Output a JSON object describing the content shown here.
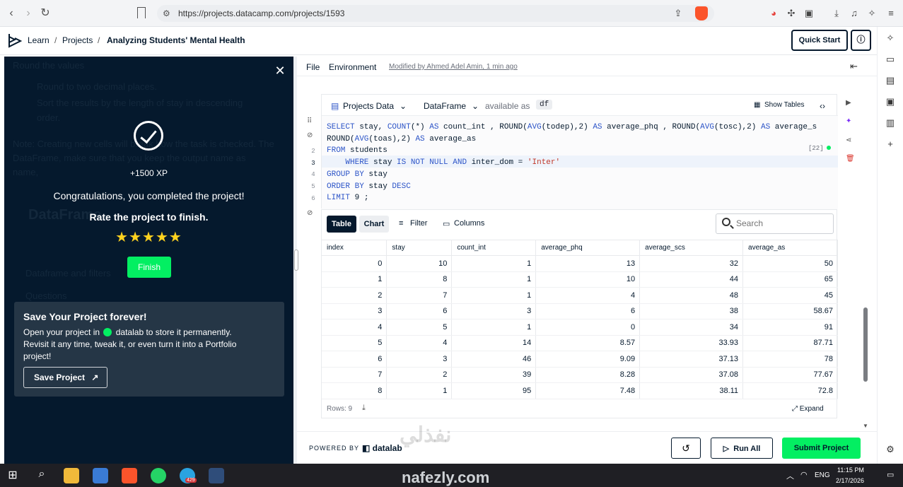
{
  "browser": {
    "url": "https://projects.datacamp.com/projects/1593",
    "notification_count": "429"
  },
  "header": {
    "breadcrumb": [
      "Learn",
      "Projects",
      "Analyzing Students' Mental Health"
    ],
    "quick_start": "Quick Start"
  },
  "panel": {
    "xp": "+1500 XP",
    "congrats": "Congratulations, you completed the project!",
    "rate": "Rate the project to finish.",
    "stars": "★★★★★",
    "finish": "Finish",
    "save_title": "Save Your Project forever!",
    "save_desc_1": "Open your project in",
    "save_desc_brand": "datalab",
    "save_desc_2": "to store it permanently. Revisit it any time, tweak it, or even turn it into a Portfolio project!",
    "save_button": "Save Project",
    "ghost": {
      "line1": "Round the values",
      "line2": "Round to two decimal places.",
      "line3": "Sort the results by the length of stay in descending",
      "line4": "order.",
      "line5": "Note: Creating new cells will break how the task is checked. The",
      "line6": "DataFrame, make sure that you keep the output name as",
      "line7": "name,",
      "line8": "DataFrame",
      "line9": "Dataframe and filters",
      "line10": "Questions"
    }
  },
  "notebook": {
    "menu": [
      "File",
      "Environment"
    ],
    "modified": "Modified by Ahmed Adel Amin, 1 min ago",
    "source": "Projects Data",
    "output_type": "DataFrame",
    "available_as": "available as",
    "df_name": "df",
    "show_tables": "Show Tables",
    "row_badge": "[22]",
    "code_lines": [
      "SELECT stay, COUNT(*) AS count_int , ROUND(AVG(todep),2) AS average_phq , ROUND(AVG(tosc),2) AS average_s",
      "ROUND(AVG(toas),2) AS average_as",
      "FROM students",
      "    WHERE stay IS NOT NULL AND inter_dom = 'Inter'",
      "GROUP BY stay",
      "ORDER BY stay DESC",
      "LIMIT 9 ;"
    ],
    "line_numbers": [
      "2",
      "3",
      "4",
      "5",
      "6"
    ]
  },
  "result": {
    "tabs": [
      "Table",
      "Chart"
    ],
    "filter": "Filter",
    "columns": "Columns",
    "search_placeholder": "Search",
    "headers": [
      "index",
      "stay",
      "count_int",
      "average_phq",
      "average_scs",
      "average_as"
    ],
    "rows": [
      [
        "0",
        "10",
        "1",
        "13",
        "32",
        "50"
      ],
      [
        "1",
        "8",
        "1",
        "10",
        "44",
        "65"
      ],
      [
        "2",
        "7",
        "1",
        "4",
        "48",
        "45"
      ],
      [
        "3",
        "6",
        "3",
        "6",
        "38",
        "58.67"
      ],
      [
        "4",
        "5",
        "1",
        "0",
        "34",
        "91"
      ],
      [
        "5",
        "4",
        "14",
        "8.57",
        "33.93",
        "87.71"
      ],
      [
        "6",
        "3",
        "46",
        "9.09",
        "37.13",
        "78"
      ],
      [
        "7",
        "2",
        "39",
        "8.28",
        "37.08",
        "77.67"
      ],
      [
        "8",
        "1",
        "95",
        "7.48",
        "38.11",
        "72.8"
      ]
    ],
    "rows_label": "Rows: 9",
    "expand": "Expand"
  },
  "footer": {
    "powered_by": "POWERED BY",
    "brand": "datalab",
    "run_all": "Run All",
    "submit": "Submit Project"
  },
  "taskbar": {
    "lang": "ENG",
    "time": "11:15 PM",
    "date": "2/17/2026"
  },
  "watermark": {
    "top": "نفذلي",
    "bottom": "nafezly.com"
  },
  "colors": {
    "navy": "#05192d",
    "green": "#03ef62",
    "card": "#253646"
  }
}
